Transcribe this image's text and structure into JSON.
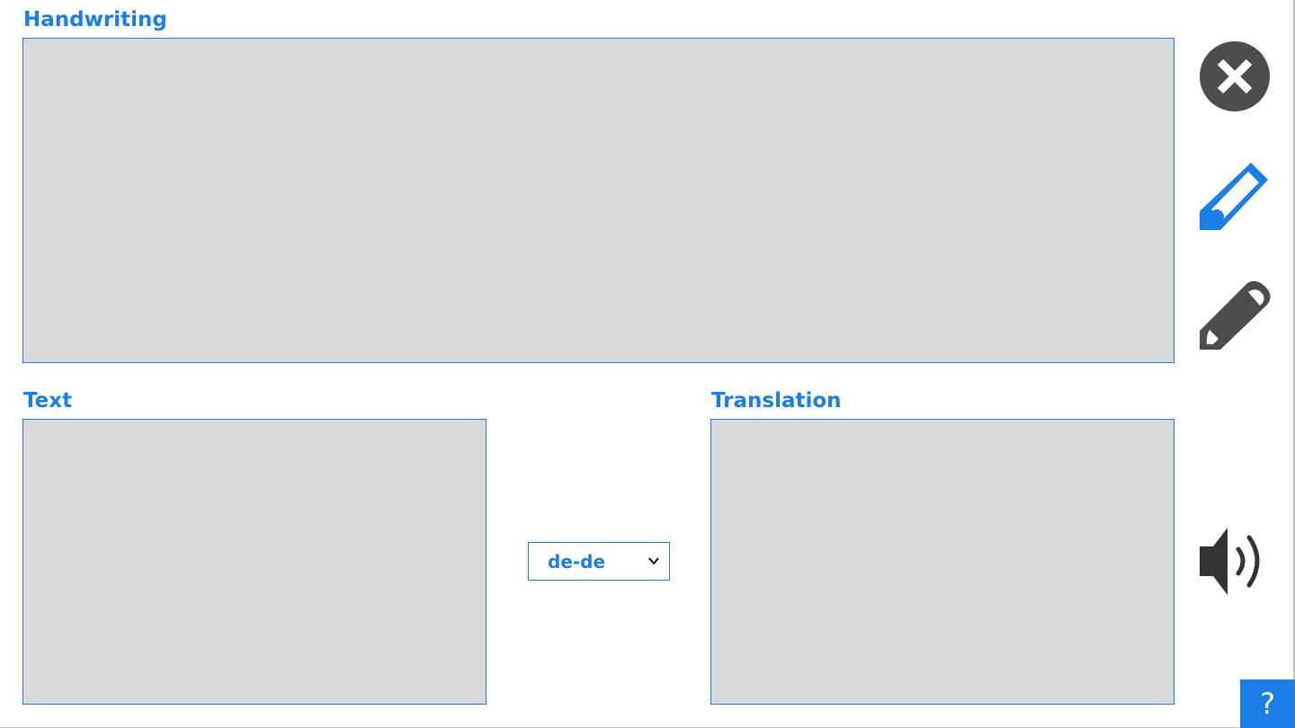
{
  "labels": {
    "handwriting": "Handwriting",
    "text": "Text",
    "translation": "Translation"
  },
  "language_select": {
    "value": "de-de"
  },
  "help": {
    "label": "?"
  },
  "icons": {
    "clear": "close-circle-icon",
    "pen": "pen-icon",
    "eraser": "eraser-icon",
    "speak": "speaker-icon",
    "dropdown": "chevron-down-icon"
  },
  "colors": {
    "accent": "#1a7ee6",
    "panel_bg": "#d9d9d9",
    "icon_dark": "#4d4d4d",
    "speaker_dark": "#333333"
  }
}
